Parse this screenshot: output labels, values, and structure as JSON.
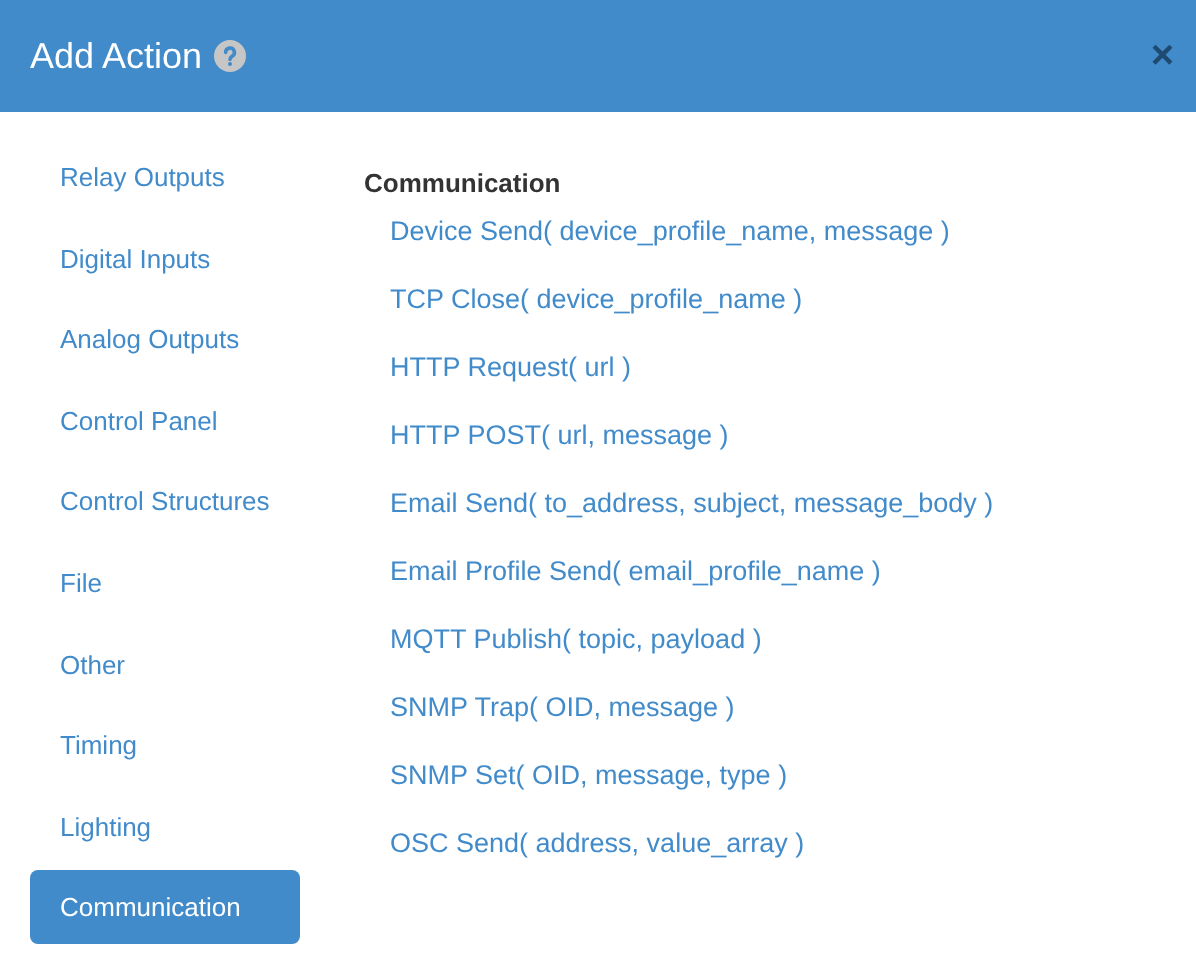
{
  "dialog": {
    "title": "Add Action",
    "close": "×"
  },
  "categories": [
    {
      "label": "Relay Outputs",
      "selected": false
    },
    {
      "label": "Digital Inputs",
      "selected": false
    },
    {
      "label": "Analog Outputs",
      "selected": false
    },
    {
      "label": "Control Panel",
      "selected": false
    },
    {
      "label": "Control Structures",
      "selected": false
    },
    {
      "label": "File",
      "selected": false
    },
    {
      "label": "Other",
      "selected": false
    },
    {
      "label": "Timing",
      "selected": false
    },
    {
      "label": "Lighting",
      "selected": false
    },
    {
      "label": "Communication",
      "selected": true
    }
  ],
  "section": {
    "heading": "Communication",
    "actions": [
      "Device Send( device_profile_name, message )",
      "TCP Close( device_profile_name )",
      "HTTP Request( url )",
      "HTTP POST( url, message )",
      "Email Send( to_address, subject, message_body )",
      "Email Profile Send( email_profile_name )",
      "MQTT Publish( topic, payload )",
      "SNMP Trap( OID, message )",
      "SNMP Set( OID, message, type )",
      "OSC Send( address, value_array )"
    ]
  }
}
